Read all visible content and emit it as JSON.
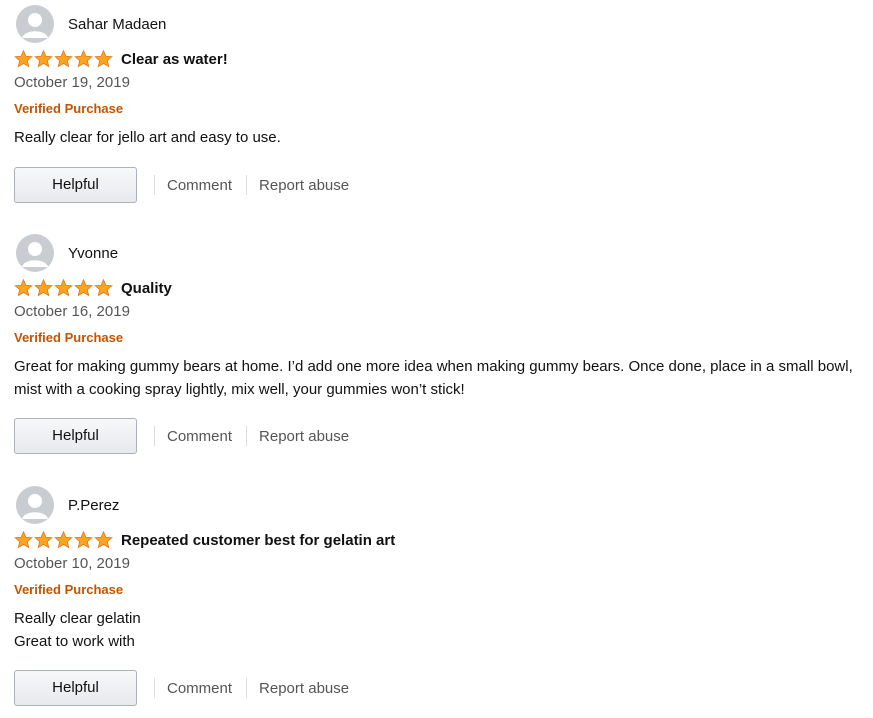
{
  "colors": {
    "star": "#ffa41c",
    "verified": "#c45500",
    "muted_text": "#555555"
  },
  "icons": {
    "avatar": "default-profile-icon",
    "star": "star-icon"
  },
  "reviews": [
    {
      "name": "Sahar Madaen",
      "rating": 5,
      "title": "Clear as water!",
      "date": "October 19, 2019",
      "verified": "Verified Purchase",
      "body": [
        "Really clear for jello art and easy to use."
      ],
      "helpful_label": "Helpful",
      "comment_label": "Comment",
      "report_label": "Report abuse"
    },
    {
      "name": "Yvonne",
      "rating": 5,
      "title": "Quality",
      "date": "October 16, 2019",
      "verified": "Verified Purchase",
      "body": [
        "Great for making gummy bears at home. I’d add one more idea when making gummy bears. Once done, place in a small bowl, mist with a cooking spray lightly, mix well, your gummies won’t stick!"
      ],
      "helpful_label": "Helpful",
      "comment_label": "Comment",
      "report_label": "Report abuse"
    },
    {
      "name": "P.Perez",
      "rating": 5,
      "title": "Repeated customer best for gelatin art",
      "date": "October 10, 2019",
      "verified": "Verified Purchase",
      "body": [
        "Really clear gelatin",
        "Great to work with"
      ],
      "helpful_label": "Helpful",
      "comment_label": "Comment",
      "report_label": "Report abuse"
    }
  ]
}
